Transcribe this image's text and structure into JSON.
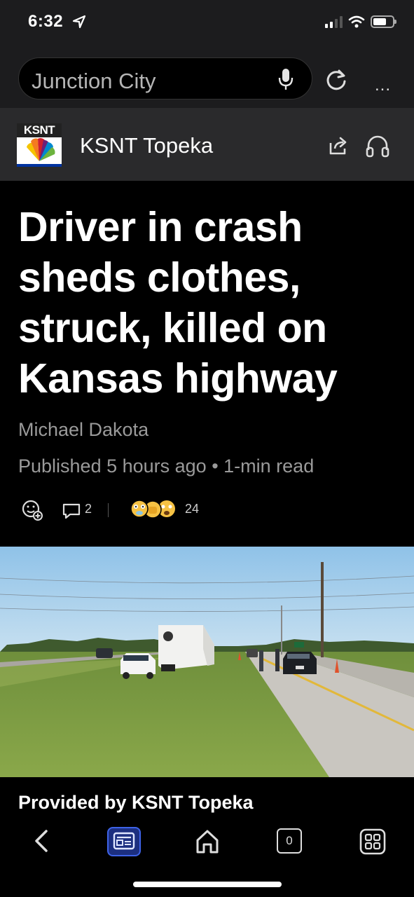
{
  "status_bar": {
    "time": "6:32"
  },
  "browser": {
    "search_text": "Junction City",
    "more_label": "..."
  },
  "publisher": {
    "logo_text": "KSNT",
    "name": "KSNT Topeka"
  },
  "article": {
    "headline": "Driver in crash sheds clothes, struck, killed on Kansas highway",
    "author": "Michael Dakota",
    "meta": "Published 5 hours ago • 1-min read",
    "comment_count": "2",
    "reaction_count": "24",
    "provided_by": "Provided by KSNT Topeka"
  },
  "bottom_nav": {
    "tabs_count": "0"
  },
  "colors": {
    "accent": "#3e63e8",
    "background": "#000000",
    "bar": "#1c1c1e"
  }
}
